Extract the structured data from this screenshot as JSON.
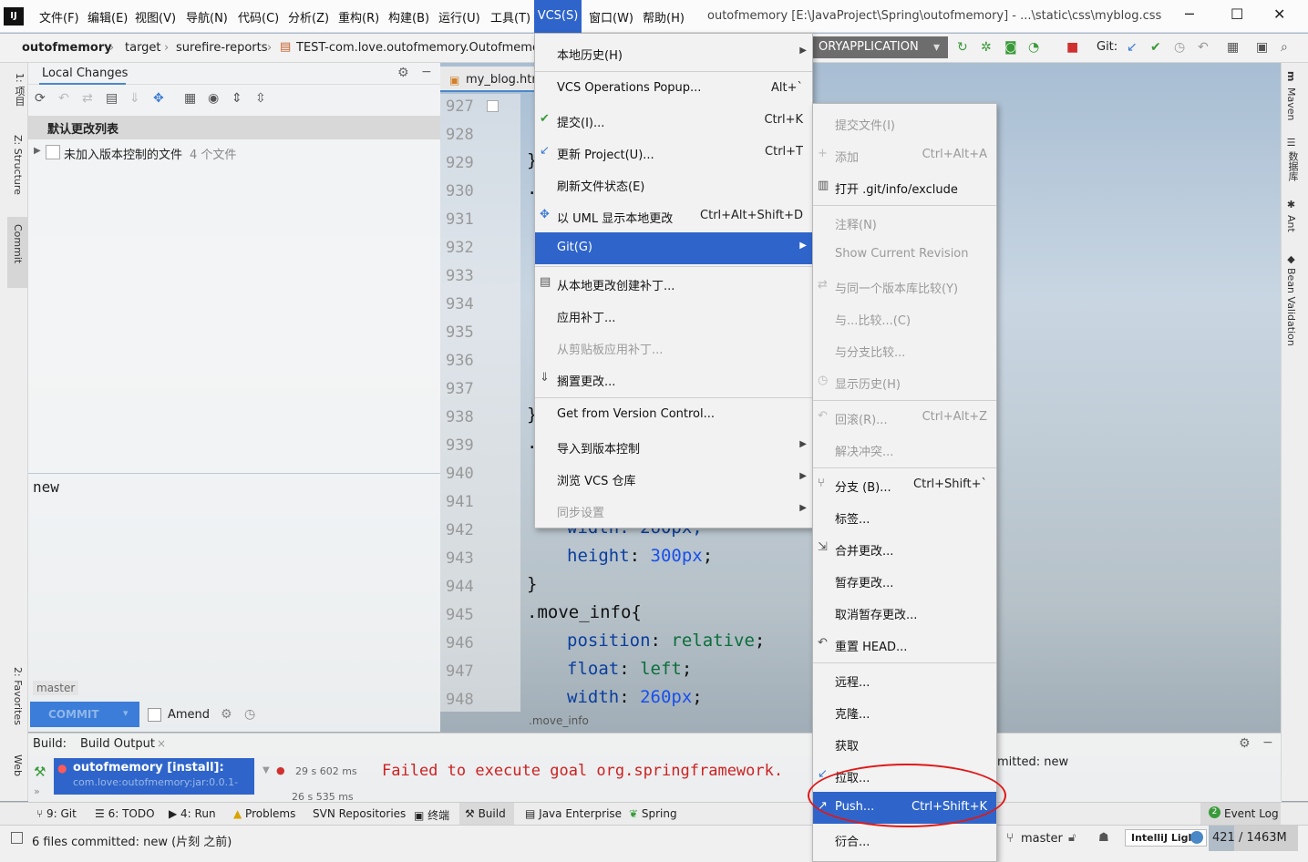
{
  "window": {
    "title": "outofmemory [E:\\JavaProject\\Spring\\outofmemory] - ...\\static\\css\\myblog.css",
    "minimize": "─",
    "maximize": "☐",
    "close": "✕"
  },
  "menubar": {
    "items": [
      "文件(F)",
      "编辑(E)",
      "视图(V)",
      "导航(N)",
      "代码(C)",
      "分析(Z)",
      "重构(R)",
      "构建(B)",
      "运行(U)",
      "工具(T)",
      "VCS(S)",
      "窗口(W)",
      "帮助(H)"
    ]
  },
  "navbar": {
    "crumbs": [
      "outofmemory",
      "target",
      "surefire-reports",
      "TEST-com.love.outofmemory.Outofmemor"
    ],
    "run_config": "ORYAPPLICATION",
    "git_label": "Git:"
  },
  "left_strip": {
    "project": "1: 项目",
    "structure": "Z: Structure",
    "commit": "Commit",
    "favorites": "2: Favorites",
    "web": "Web"
  },
  "local_changes": {
    "tab": "Local Changes",
    "changelist": "默认更改列表",
    "unversioned": "未加入版本控制的文件",
    "unversioned_count": "4 个文件"
  },
  "commit_panel": {
    "message": "new",
    "branch": "master",
    "commit_button": "COMMIT",
    "amend": "Amend"
  },
  "editor": {
    "tab": "my_blog.htm",
    "line_numbers": [
      "927",
      "928",
      "929",
      "930",
      "931",
      "932",
      "933",
      "934",
      "935",
      "936",
      "937",
      "938",
      "939",
      "940",
      "941",
      "942",
      "943",
      "944",
      "945",
      "946",
      "947",
      "948"
    ],
    "code": {
      "l929": "}",
      "l930": ".",
      "l938": "}",
      "l939": ".",
      "l942": "width: 260px;",
      "l943_prop": "height",
      "l943_val": "300px",
      "l944": "}",
      "l945": ".move_info{",
      "l946_prop": "position",
      "l946_val": "relative",
      "l947_prop": "float",
      "l947_val": "left",
      "l948_prop": "width",
      "l948_val": "260px"
    },
    "breadcrumb": ".move_info"
  },
  "build": {
    "label": "Build:",
    "tab": "Build Output",
    "node": "outofmemory [install]:",
    "node_sub": "com.love:outofmemory:jar:0.0.1-",
    "time1": "29 s 602 ms",
    "time2": "26 s 535 ms",
    "error": "Failed to execute goal org.springframework.",
    "committed": "mitted: new"
  },
  "tool_windows": [
    "9: Git",
    "6: TODO",
    "4: Run",
    "Problems",
    "SVN Repositories",
    "终端",
    "Build",
    "Java Enterprise",
    "Spring"
  ],
  "event_log": "Event Log",
  "event_log_count": "2",
  "status": {
    "text": "6 files committed: new (片刻 之前)",
    "branch": "master",
    "theme": "IntelliJ Light",
    "memory": "421 / 1463M"
  },
  "right_strip": [
    "Maven",
    "数据库",
    "Ant",
    "Bean Validation"
  ],
  "vcs_menu": {
    "items": [
      {
        "label": "本地历史(H)",
        "shortcut": "",
        "submenu": true,
        "disabled": false,
        "selected": false
      },
      {
        "label": "VCS Operations Popup...",
        "shortcut": "Alt+`",
        "submenu": false,
        "disabled": false,
        "selected": false
      },
      {
        "label": "提交(I)...",
        "shortcut": "Ctrl+K",
        "submenu": false,
        "disabled": false,
        "selected": false
      },
      {
        "label": "更新 Project(U)...",
        "shortcut": "Ctrl+T",
        "submenu": false,
        "disabled": false,
        "selected": false
      },
      {
        "label": "刷新文件状态(E)",
        "shortcut": "",
        "submenu": false,
        "disabled": false,
        "selected": false
      },
      {
        "label": "以 UML 显示本地更改",
        "shortcut": "Ctrl+Alt+Shift+D",
        "submenu": false,
        "disabled": false,
        "selected": false
      },
      {
        "label": "Git(G)",
        "shortcut": "",
        "submenu": true,
        "disabled": false,
        "selected": true
      },
      {
        "label": "从本地更改创建补丁...",
        "shortcut": "",
        "submenu": false,
        "disabled": false,
        "selected": false
      },
      {
        "label": "应用补丁...",
        "shortcut": "",
        "submenu": false,
        "disabled": false,
        "selected": false
      },
      {
        "label": "从剪贴板应用补丁...",
        "shortcut": "",
        "submenu": false,
        "disabled": true,
        "selected": false
      },
      {
        "label": "搁置更改...",
        "shortcut": "",
        "submenu": false,
        "disabled": false,
        "selected": false
      },
      {
        "label": "Get from Version Control...",
        "shortcut": "",
        "submenu": false,
        "disabled": false,
        "selected": false
      },
      {
        "label": "导入到版本控制",
        "shortcut": "",
        "submenu": true,
        "disabled": false,
        "selected": false
      },
      {
        "label": "浏览 VCS 仓库",
        "shortcut": "",
        "submenu": true,
        "disabled": false,
        "selected": false
      },
      {
        "label": "同步设置",
        "shortcut": "",
        "submenu": true,
        "disabled": true,
        "selected": false
      }
    ]
  },
  "git_menu": {
    "items": [
      {
        "label": "提交文件(I)",
        "shortcut": "",
        "disabled": true,
        "selected": false
      },
      {
        "label": "添加",
        "shortcut": "Ctrl+Alt+A",
        "disabled": true,
        "selected": false
      },
      {
        "label": "打开 .git/info/exclude",
        "shortcut": "",
        "disabled": false,
        "selected": false
      },
      {
        "label": "注释(N)",
        "shortcut": "",
        "disabled": true,
        "selected": false
      },
      {
        "label": "Show Current Revision",
        "shortcut": "",
        "disabled": true,
        "selected": false
      },
      {
        "label": "与同一个版本库比较(Y)",
        "shortcut": "",
        "disabled": true,
        "selected": false
      },
      {
        "label": "与...比较...(C)",
        "shortcut": "",
        "disabled": true,
        "selected": false
      },
      {
        "label": "与分支比较...",
        "shortcut": "",
        "disabled": true,
        "selected": false
      },
      {
        "label": "显示历史(H)",
        "shortcut": "",
        "disabled": true,
        "selected": false
      },
      {
        "label": "回滚(R)...",
        "shortcut": "Ctrl+Alt+Z",
        "disabled": true,
        "selected": false
      },
      {
        "label": "解决冲突...",
        "shortcut": "",
        "disabled": true,
        "selected": false
      },
      {
        "label": "分支 (B)...",
        "shortcut": "Ctrl+Shift+`",
        "disabled": false,
        "selected": false
      },
      {
        "label": "标签...",
        "shortcut": "",
        "disabled": false,
        "selected": false
      },
      {
        "label": "合并更改...",
        "shortcut": "",
        "disabled": false,
        "selected": false
      },
      {
        "label": "暂存更改...",
        "shortcut": "",
        "disabled": false,
        "selected": false
      },
      {
        "label": "取消暂存更改...",
        "shortcut": "",
        "disabled": false,
        "selected": false
      },
      {
        "label": "重置 HEAD...",
        "shortcut": "",
        "disabled": false,
        "selected": false
      },
      {
        "label": "远程...",
        "shortcut": "",
        "disabled": false,
        "selected": false
      },
      {
        "label": "克隆...",
        "shortcut": "",
        "disabled": false,
        "selected": false
      },
      {
        "label": "获取",
        "shortcut": "",
        "disabled": false,
        "selected": false
      },
      {
        "label": "拉取...",
        "shortcut": "",
        "disabled": false,
        "selected": false
      },
      {
        "label": "Push...",
        "shortcut": "Ctrl+Shift+K",
        "disabled": false,
        "selected": true
      },
      {
        "label": "衍合...",
        "shortcut": "",
        "disabled": false,
        "selected": false
      }
    ]
  },
  "colors": {
    "selection": "#2f65ca",
    "error": "#cc2222",
    "annotation": "#e01818"
  }
}
